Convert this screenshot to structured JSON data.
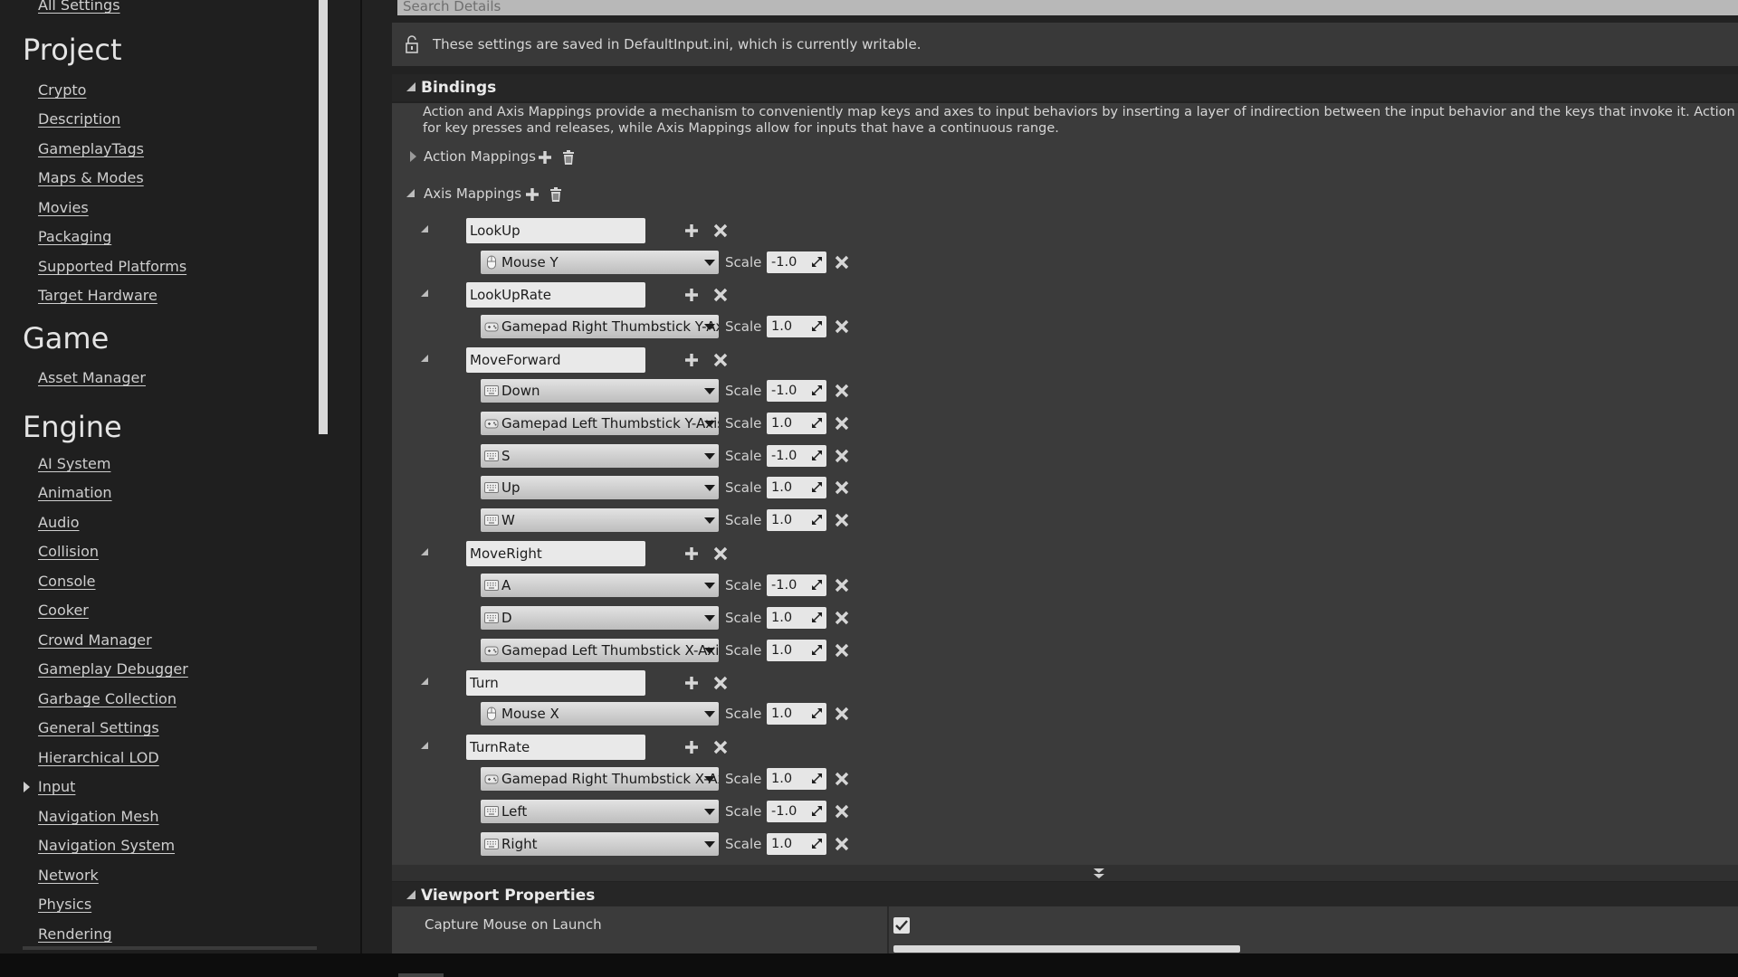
{
  "sidebar": {
    "top_link": "All Settings",
    "sections": [
      {
        "title": "Project",
        "items": [
          "Crypto",
          "Description",
          "GameplayTags",
          "Maps & Modes",
          "Movies",
          "Packaging",
          "Supported Platforms",
          "Target Hardware"
        ]
      },
      {
        "title": "Game",
        "items": [
          "Asset Manager"
        ]
      },
      {
        "title": "Engine",
        "items": [
          "AI System",
          "Animation",
          "Audio",
          "Collision",
          "Console",
          "Cooker",
          "Crowd Manager",
          "Gameplay Debugger",
          "Garbage Collection",
          "General Settings",
          "Hierarchical LOD",
          "Input",
          "Navigation Mesh",
          "Navigation System",
          "Network",
          "Physics",
          "Rendering"
        ]
      }
    ],
    "expanded_item": "Input"
  },
  "details": {
    "search_placeholder": "Search Details",
    "notice": "These settings are saved in DefaultInput.ini, which is currently writable."
  },
  "bindings": {
    "title": "Bindings",
    "description_line1": "Action and Axis Mappings provide a mechanism to conveniently map keys and axes to input behaviors by inserting a layer of indirection between the input behavior and the keys that invoke it. Action Mappin",
    "description_line2": "for key presses and releases, while Axis Mappings allow for inputs that have a continuous range.",
    "action_mappings_label": "Action Mappings",
    "axis_mappings_label": "Axis Mappings",
    "scale_label": "Scale",
    "axis_mappings": [
      {
        "name": "LookUp",
        "keys": [
          {
            "key": "Mouse Y",
            "icon": "mouse-icon",
            "scale": "-1.0"
          }
        ]
      },
      {
        "name": "LookUpRate",
        "keys": [
          {
            "key": "Gamepad Right Thumbstick Y-Axis",
            "icon": "gamepad-icon",
            "scale": "1.0"
          }
        ]
      },
      {
        "name": "MoveForward",
        "keys": [
          {
            "key": "Down",
            "icon": "keyboard-icon",
            "scale": "-1.0"
          },
          {
            "key": "Gamepad Left Thumbstick Y-Axis",
            "icon": "gamepad-icon",
            "scale": "1.0"
          },
          {
            "key": "S",
            "icon": "keyboard-icon",
            "scale": "-1.0"
          },
          {
            "key": "Up",
            "icon": "keyboard-icon",
            "scale": "1.0"
          },
          {
            "key": "W",
            "icon": "keyboard-icon",
            "scale": "1.0"
          }
        ]
      },
      {
        "name": "MoveRight",
        "keys": [
          {
            "key": "A",
            "icon": "keyboard-icon",
            "scale": "-1.0"
          },
          {
            "key": "D",
            "icon": "keyboard-icon",
            "scale": "1.0"
          },
          {
            "key": "Gamepad Left Thumbstick X-Axis",
            "icon": "gamepad-icon",
            "scale": "1.0"
          }
        ]
      },
      {
        "name": "Turn",
        "keys": [
          {
            "key": "Mouse X",
            "icon": "mouse-icon",
            "scale": "1.0"
          }
        ]
      },
      {
        "name": "TurnRate",
        "keys": [
          {
            "key": "Gamepad Right Thumbstick X-Axis",
            "icon": "gamepad-icon",
            "scale": "1.0"
          },
          {
            "key": "Left",
            "icon": "keyboard-icon",
            "scale": "-1.0"
          },
          {
            "key": "Right",
            "icon": "keyboard-icon",
            "scale": "1.0"
          }
        ]
      }
    ]
  },
  "viewport": {
    "title": "Viewport Properties",
    "capture_mouse_label": "Capture Mouse on Launch",
    "capture_mouse_checked": true
  }
}
